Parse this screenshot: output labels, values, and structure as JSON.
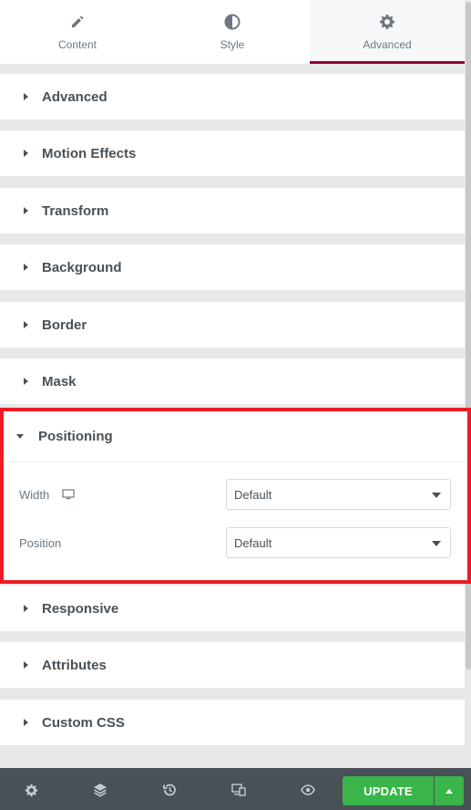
{
  "tabs": [
    {
      "label": "Content",
      "icon": "pencil-icon"
    },
    {
      "label": "Style",
      "icon": "contrast-icon"
    },
    {
      "label": "Advanced",
      "icon": "gear-icon"
    }
  ],
  "sections_top": [
    {
      "title": "Advanced"
    },
    {
      "title": "Motion Effects"
    },
    {
      "title": "Transform"
    },
    {
      "title": "Background"
    },
    {
      "title": "Border"
    },
    {
      "title": "Mask"
    }
  ],
  "positioning": {
    "title": "Positioning",
    "width": {
      "label": "Width",
      "value": "Default",
      "device_icon": "desktop-icon"
    },
    "position": {
      "label": "Position",
      "value": "Default"
    }
  },
  "sections_bottom": [
    {
      "title": "Responsive"
    },
    {
      "title": "Attributes"
    },
    {
      "title": "Custom CSS"
    }
  ],
  "footer": {
    "icons": [
      "settings-icon",
      "layers-icon",
      "history-icon",
      "responsive-icon",
      "preview-icon"
    ],
    "update_label": "UPDATE"
  },
  "colors": {
    "accent": "#93003c",
    "highlight": "#ed1c24",
    "update": "#39b54a",
    "footer": "#495157"
  }
}
